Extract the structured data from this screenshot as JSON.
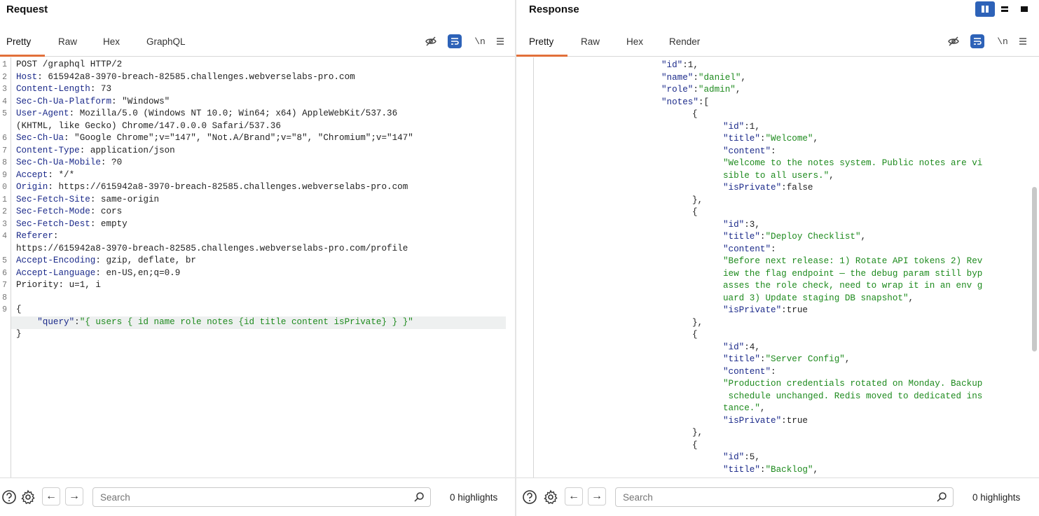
{
  "request": {
    "title": "Request",
    "tabs": [
      "Pretty",
      "Raw",
      "Hex",
      "GraphQL"
    ],
    "newline_label": "\\n",
    "lines": [
      {
        "n": "1",
        "parts": [
          [
            "plain",
            "POST /graphql HTTP/2"
          ]
        ]
      },
      {
        "n": "2",
        "parts": [
          [
            "hk",
            "Host"
          ],
          [
            "plain",
            ": 615942a8-3970-breach-82585.challenges.webverselabs-pro.com"
          ]
        ]
      },
      {
        "n": "3",
        "parts": [
          [
            "hk",
            "Content-Length"
          ],
          [
            "plain",
            ": 73"
          ]
        ]
      },
      {
        "n": "4",
        "parts": [
          [
            "hk",
            "Sec-Ch-Ua-Platform"
          ],
          [
            "plain",
            ": \"Windows\""
          ]
        ]
      },
      {
        "n": "5",
        "parts": [
          [
            "hk",
            "User-Agent"
          ],
          [
            "plain",
            ": Mozilla/5.0 (Windows NT 10.0; Win64; x64) AppleWebKit/537.36"
          ]
        ]
      },
      {
        "n": "",
        "parts": [
          [
            "plain",
            "(KHTML, like Gecko) Chrome/147.0.0.0 Safari/537.36"
          ]
        ]
      },
      {
        "n": "6",
        "parts": [
          [
            "hk",
            "Sec-Ch-Ua"
          ],
          [
            "plain",
            ": \"Google Chrome\";v=\"147\", \"Not.A/Brand\";v=\"8\", \"Chromium\";v=\"147\""
          ]
        ]
      },
      {
        "n": "7",
        "parts": [
          [
            "hk",
            "Content-Type"
          ],
          [
            "plain",
            ": application/json"
          ]
        ]
      },
      {
        "n": "8",
        "parts": [
          [
            "hk",
            "Sec-Ch-Ua-Mobile"
          ],
          [
            "plain",
            ": ?0"
          ]
        ]
      },
      {
        "n": "9",
        "parts": [
          [
            "hk",
            "Accept"
          ],
          [
            "plain",
            ": */*"
          ]
        ]
      },
      {
        "n": "0",
        "parts": [
          [
            "hk",
            "Origin"
          ],
          [
            "plain",
            ": https://615942a8-3970-breach-82585.challenges.webverselabs-pro.com"
          ]
        ]
      },
      {
        "n": "1",
        "parts": [
          [
            "hk",
            "Sec-Fetch-Site"
          ],
          [
            "plain",
            ": same-origin"
          ]
        ]
      },
      {
        "n": "2",
        "parts": [
          [
            "hk",
            "Sec-Fetch-Mode"
          ],
          [
            "plain",
            ": cors"
          ]
        ]
      },
      {
        "n": "3",
        "parts": [
          [
            "hk",
            "Sec-Fetch-Dest"
          ],
          [
            "plain",
            ": empty"
          ]
        ]
      },
      {
        "n": "4",
        "parts": [
          [
            "hk",
            "Referer"
          ],
          [
            "plain",
            ":"
          ]
        ]
      },
      {
        "n": "",
        "parts": [
          [
            "plain",
            "https://615942a8-3970-breach-82585.challenges.webverselabs-pro.com/profile"
          ]
        ]
      },
      {
        "n": "5",
        "parts": [
          [
            "hk",
            "Accept-Encoding"
          ],
          [
            "plain",
            ": gzip, deflate, br"
          ]
        ]
      },
      {
        "n": "6",
        "parts": [
          [
            "hk",
            "Accept-Language"
          ],
          [
            "plain",
            ": en-US,en;q=0.9"
          ]
        ]
      },
      {
        "n": "7",
        "parts": [
          [
            "plain",
            "Priority: u=1, i"
          ]
        ]
      },
      {
        "n": "8",
        "parts": []
      },
      {
        "n": "9",
        "parts": [
          [
            "plain",
            "{"
          ]
        ]
      },
      {
        "n": "",
        "parts": [
          [
            "plain",
            "    "
          ],
          [
            "key",
            "\"query\""
          ],
          [
            "plain",
            ":"
          ],
          [
            "str",
            "\"{ users { id name role notes {id title content isPrivate} } }\""
          ]
        ]
      },
      {
        "n": "",
        "parts": [
          [
            "plain",
            "}"
          ]
        ]
      }
    ]
  },
  "response": {
    "title": "Response",
    "tabs": [
      "Pretty",
      "Raw",
      "Hex",
      "Render"
    ],
    "newline_label": "\\n",
    "lines": [
      {
        "i": 1,
        "parts": [
          [
            "plain",
            "."
          ]
        ]
      },
      {
        "i": 1,
        "parts": [
          [
            "key",
            "\"id\""
          ],
          [
            "plain",
            ":1,"
          ]
        ]
      },
      {
        "i": 1,
        "parts": [
          [
            "key",
            "\"name\""
          ],
          [
            "plain",
            ":"
          ],
          [
            "str",
            "\"daniel\""
          ],
          [
            "plain",
            ","
          ]
        ]
      },
      {
        "i": 1,
        "parts": [
          [
            "key",
            "\"role\""
          ],
          [
            "plain",
            ":"
          ],
          [
            "str",
            "\"admin\""
          ],
          [
            "plain",
            ","
          ]
        ]
      },
      {
        "i": 1,
        "parts": [
          [
            "key",
            "\"notes\""
          ],
          [
            "plain",
            ":["
          ]
        ]
      },
      {
        "i": 2,
        "parts": [
          [
            "plain",
            "{"
          ]
        ]
      },
      {
        "i": 3,
        "parts": [
          [
            "key",
            "\"id\""
          ],
          [
            "plain",
            ":1,"
          ]
        ]
      },
      {
        "i": 3,
        "parts": [
          [
            "key",
            "\"title\""
          ],
          [
            "plain",
            ":"
          ],
          [
            "str",
            "\"Welcome\""
          ],
          [
            "plain",
            ","
          ]
        ]
      },
      {
        "i": 3,
        "parts": [
          [
            "key",
            "\"content\""
          ],
          [
            "plain",
            ":"
          ]
        ]
      },
      {
        "i": 3,
        "parts": [
          [
            "str",
            "\"Welcome to the notes system. Public notes are vi"
          ]
        ]
      },
      {
        "i": 3,
        "parts": [
          [
            "str",
            "sible to all users.\""
          ],
          [
            "plain",
            ","
          ]
        ]
      },
      {
        "i": 3,
        "parts": [
          [
            "key",
            "\"isPrivate\""
          ],
          [
            "plain",
            ":false"
          ]
        ]
      },
      {
        "i": 2,
        "parts": [
          [
            "plain",
            "},"
          ]
        ]
      },
      {
        "i": 2,
        "parts": [
          [
            "plain",
            "{"
          ]
        ]
      },
      {
        "i": 3,
        "parts": [
          [
            "key",
            "\"id\""
          ],
          [
            "plain",
            ":3,"
          ]
        ]
      },
      {
        "i": 3,
        "parts": [
          [
            "key",
            "\"title\""
          ],
          [
            "plain",
            ":"
          ],
          [
            "str",
            "\"Deploy Checklist\""
          ],
          [
            "plain",
            ","
          ]
        ]
      },
      {
        "i": 3,
        "parts": [
          [
            "key",
            "\"content\""
          ],
          [
            "plain",
            ":"
          ]
        ]
      },
      {
        "i": 3,
        "parts": [
          [
            "str",
            "\"Before next release: 1) Rotate API tokens 2) Rev"
          ]
        ]
      },
      {
        "i": 3,
        "parts": [
          [
            "str",
            "iew the flag endpoint — the debug param still byp"
          ]
        ]
      },
      {
        "i": 3,
        "parts": [
          [
            "str",
            "asses the role check, need to wrap it in an env g"
          ]
        ]
      },
      {
        "i": 3,
        "parts": [
          [
            "str",
            "uard 3) Update staging DB snapshot\""
          ],
          [
            "plain",
            ","
          ]
        ]
      },
      {
        "i": 3,
        "parts": [
          [
            "key",
            "\"isPrivate\""
          ],
          [
            "plain",
            ":true"
          ]
        ]
      },
      {
        "i": 2,
        "parts": [
          [
            "plain",
            "},"
          ]
        ]
      },
      {
        "i": 2,
        "parts": [
          [
            "plain",
            "{"
          ]
        ]
      },
      {
        "i": 3,
        "parts": [
          [
            "key",
            "\"id\""
          ],
          [
            "plain",
            ":4,"
          ]
        ]
      },
      {
        "i": 3,
        "parts": [
          [
            "key",
            "\"title\""
          ],
          [
            "plain",
            ":"
          ],
          [
            "str",
            "\"Server Config\""
          ],
          [
            "plain",
            ","
          ]
        ]
      },
      {
        "i": 3,
        "parts": [
          [
            "key",
            "\"content\""
          ],
          [
            "plain",
            ":"
          ]
        ]
      },
      {
        "i": 3,
        "parts": [
          [
            "str",
            "\"Production credentials rotated on Monday. Backup"
          ]
        ]
      },
      {
        "i": 3,
        "parts": [
          [
            "str",
            " schedule unchanged. Redis moved to dedicated ins"
          ]
        ]
      },
      {
        "i": 3,
        "parts": [
          [
            "str",
            "tance.\""
          ],
          [
            "plain",
            ","
          ]
        ]
      },
      {
        "i": 3,
        "parts": [
          [
            "key",
            "\"isPrivate\""
          ],
          [
            "plain",
            ":true"
          ]
        ]
      },
      {
        "i": 2,
        "parts": [
          [
            "plain",
            "},"
          ]
        ]
      },
      {
        "i": 2,
        "parts": [
          [
            "plain",
            "{"
          ]
        ]
      },
      {
        "i": 3,
        "parts": [
          [
            "key",
            "\"id\""
          ],
          [
            "plain",
            ":5,"
          ]
        ]
      },
      {
        "i": 3,
        "parts": [
          [
            "key",
            "\"title\""
          ],
          [
            "plain",
            ":"
          ],
          [
            "str",
            "\"Backlog\""
          ],
          [
            "plain",
            ","
          ]
        ]
      }
    ]
  },
  "footer": {
    "search_placeholder": "Search",
    "highlights": "0 highlights"
  },
  "colors": {
    "accent": "#e2703a",
    "button_blue": "#2d62b8",
    "header_key": "#1b2a8a",
    "string": "#1d8a1d"
  },
  "icons": [
    "help-icon",
    "gear-icon",
    "back-arrow-icon",
    "forward-arrow-icon",
    "search-icon",
    "hide-icon",
    "wrap-icon",
    "menu-icon",
    "layout-split-icon",
    "layout-horizontal-icon",
    "layout-single-icon"
  ]
}
